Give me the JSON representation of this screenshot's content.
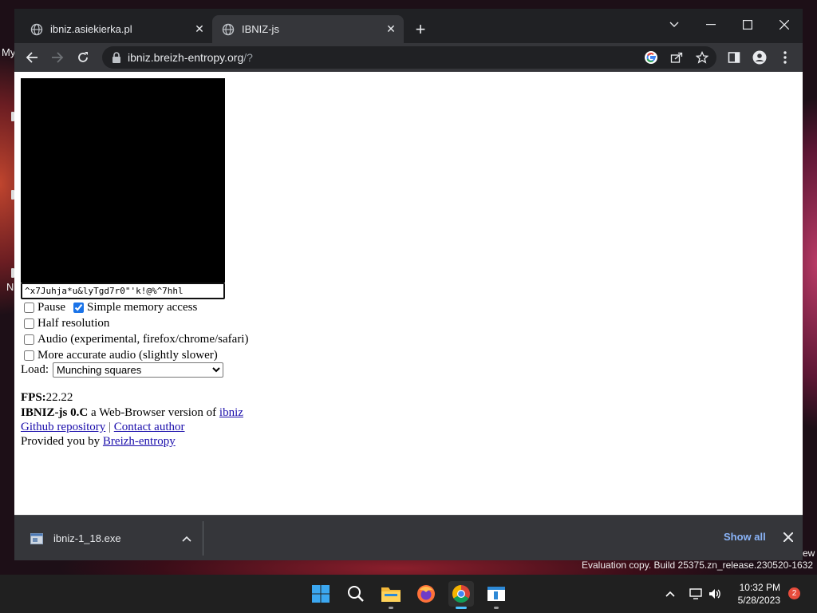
{
  "desktop": {
    "left_fragments": [
      "My",
      "N"
    ],
    "right_fragment": "ew",
    "eval_text": "Evaluation copy. Build 25375.zn_release.230520-1632"
  },
  "browser": {
    "tabs": [
      {
        "title": "ibniz.asiekierka.pl",
        "icon": "globe-icon",
        "active": false
      },
      {
        "title": "IBNIZ-js",
        "icon": "globe-icon",
        "active": true
      }
    ],
    "address": {
      "host": "ibniz.breizh-entropy.org",
      "path": "/?"
    }
  },
  "page": {
    "code_value": "^x7Juhja*u&lyTgd7r0\"'k!@%^7hhl",
    "options": [
      {
        "label": "Pause",
        "checked": false
      },
      {
        "label": "Simple memory access",
        "checked": true
      },
      {
        "label": "Half resolution",
        "checked": false
      },
      {
        "label": "Audio (experimental, firefox/chrome/safari)",
        "checked": false
      },
      {
        "label": "More accurate audio (slightly slower)",
        "checked": false
      }
    ],
    "load_label": "Load:",
    "load_selected": "Munching squares",
    "fps_label": "FPS:",
    "fps_value": "22.22",
    "title_bold": "IBNIZ-js 0.C",
    "title_rest": " a Web-Browser version of ",
    "ibniz_link": "ibniz",
    "github_link": "Github repository",
    "separator": "|",
    "contact_link": "Contact author",
    "provided_by": "Provided you by ",
    "breizh_link": "Breizh-entropy"
  },
  "downloads": {
    "filename": "ibniz-1_18.exe",
    "show_all": "Show all"
  },
  "taskbar": {
    "time": "10:32 PM",
    "date": "5/28/2023",
    "notification_count": "2"
  },
  "colors": {
    "accent": "#1a73e8",
    "link": "#1a0dab",
    "show_all": "#8ab4f8"
  }
}
